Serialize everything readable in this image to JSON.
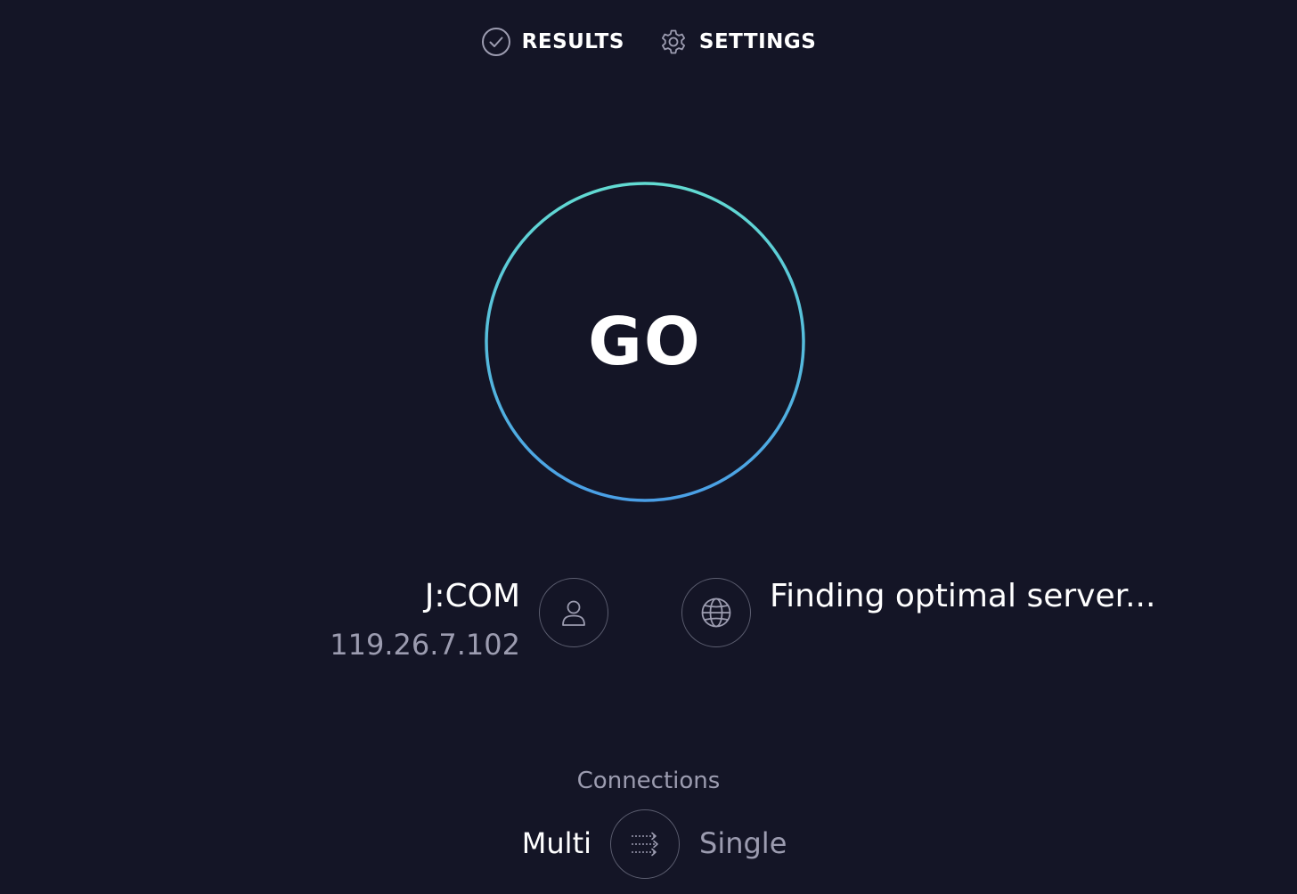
{
  "nav": {
    "results_label": "RESULTS",
    "settings_label": "SETTINGS",
    "results_icon": "check-circle-icon",
    "settings_icon": "gear-icon"
  },
  "go": {
    "label": "GO",
    "ring_color_top": "#62dbd2",
    "ring_color_bottom": "#4a9fe6"
  },
  "isp": {
    "name": "J:COM",
    "ip": "119.26.7.102",
    "icon": "user-icon"
  },
  "server": {
    "status": "Finding optimal server...",
    "icon": "globe-icon"
  },
  "connections": {
    "label": "Connections",
    "multi_label": "Multi",
    "single_label": "Single",
    "selected": "Multi",
    "icon": "connections-arrows-icon"
  },
  "colors": {
    "background": "#141526",
    "muted_text": "#9c9cb0",
    "icon_stroke": "#9c9cb0",
    "circle_border": "#5c5e70"
  }
}
